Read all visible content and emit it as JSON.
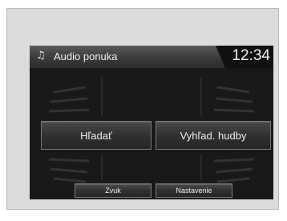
{
  "header": {
    "icon": "music-note-icon",
    "title": "Audio ponuka",
    "clock": "12:34"
  },
  "main_buttons": {
    "search": "Hľadať",
    "music_search": "Vyhľad. hudby"
  },
  "bottom_tabs": {
    "sound": "Zvuk",
    "settings": "Nastavenie"
  }
}
